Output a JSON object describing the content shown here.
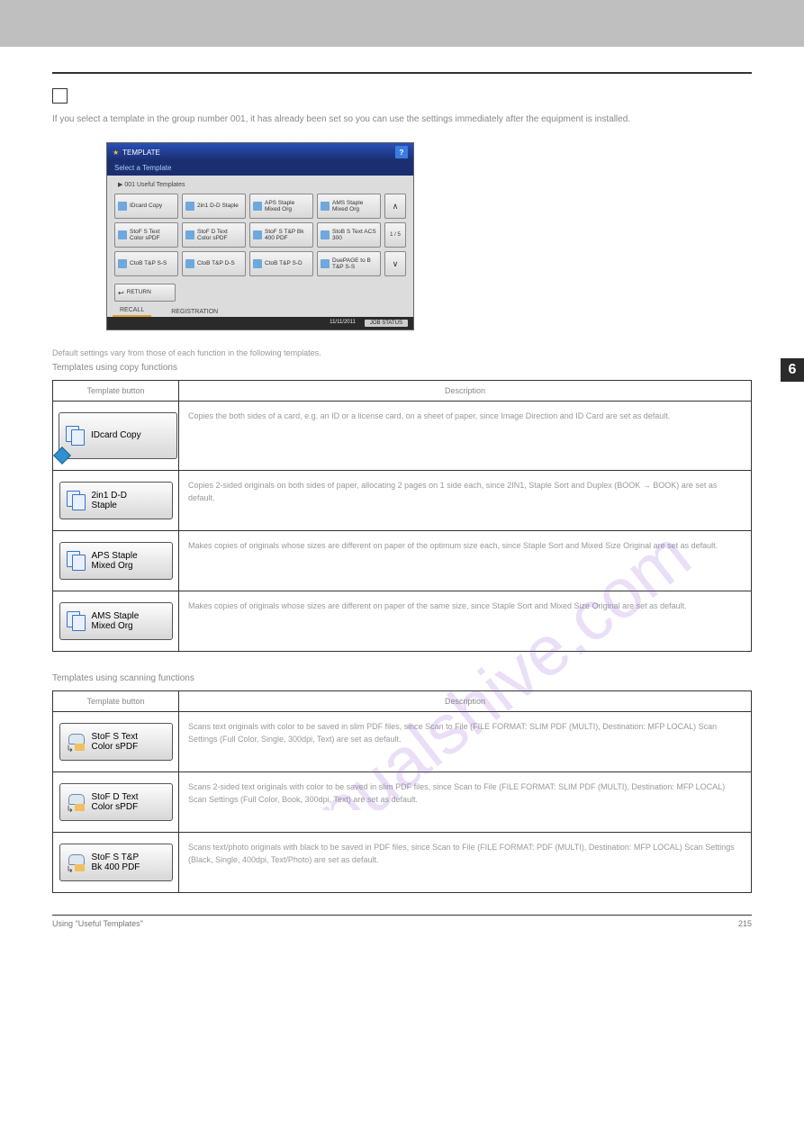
{
  "chapterTab": "6",
  "intro": "If you select a template in the group number 001, it has already been set so you can use the settings immediately after the equipment is installed.",
  "screen": {
    "title": "TEMPLATE",
    "subtitle": "Select a Template",
    "caption": "001 Useful Templates",
    "buttons": [
      [
        {
          "label": "IDcard Copy"
        },
        {
          "label": "2in1 D-D Staple"
        },
        {
          "label": "APS Staple Mixed Org"
        },
        {
          "label": "AMS Staple Mixed Org"
        }
      ],
      [
        {
          "label": "StoF S Text Color sPDF"
        },
        {
          "label": "StoF D Text Color sPDF"
        },
        {
          "label": "StoF S T&P Bk 400 PDF"
        },
        {
          "label": "StoB S Text ACS 300"
        }
      ],
      [
        {
          "label": "CtoB T&P S-S"
        },
        {
          "label": "CtoB T&P D-S"
        },
        {
          "label": "CtoB T&P S-D"
        },
        {
          "label": "DuePAGE to B T&P S-S"
        }
      ]
    ],
    "nav": {
      "up": "∧",
      "page": "1 / 5",
      "down": "∨"
    },
    "return": "RETURN",
    "tabs": {
      "recall": "RECALL",
      "registration": "REGISTRATION"
    },
    "footer": {
      "date": "11/11/2011",
      "job": "JOB STATUS"
    }
  },
  "midnote": "Default settings vary from those of each function in the following templates.",
  "copyTable": {
    "heading": "Templates using copy functions",
    "cols": {
      "c1": "Template button",
      "c2": "Description"
    },
    "rows": [
      {
        "label": "IDcard Copy",
        "desc": "Copies the both sides of a card, e.g. an ID or a license card, on a sheet of paper, since Image Direction and ID Card are set as default.",
        "big": true
      },
      {
        "label": "2in1 D-D\nStaple",
        "desc": "Copies 2-sided originals on both sides of paper, allocating 2 pages on 1 side each, since 2IN1, Staple Sort and Duplex (BOOK → BOOK) are set as default."
      },
      {
        "label": "APS Staple\nMixed Org",
        "desc": "Makes copies of originals whose sizes are different on paper of the optimum size each, since Staple Sort and Mixed Size Original are set as default."
      },
      {
        "label": "AMS Staple\nMixed Org",
        "desc": "Makes copies of originals whose sizes are different on paper of the same size, since Staple Sort and Mixed Size Original are set as default."
      }
    ]
  },
  "scanTable": {
    "heading": "Templates using scanning functions",
    "cols": {
      "c1": "Template button",
      "c2": "Description"
    },
    "rows": [
      {
        "label": "StoF S Text\nColor sPDF",
        "desc": "Scans text originals with color to be saved in slim PDF files, since Scan to File (FILE FORMAT: SLIM PDF (MULTI), Destination: MFP LOCAL) Scan Settings (Full Color, Single, 300dpi, Text) are set as default."
      },
      {
        "label": "StoF D Text\nColor sPDF",
        "desc": "Scans 2-sided text originals with color to be saved in slim PDF files, since Scan to File (FILE FORMAT: SLIM PDF (MULTI), Destination: MFP LOCAL) Scan Settings (Full Color, Book, 300dpi, Text) are set as default."
      },
      {
        "label": "StoF S T&P\nBk 400 PDF",
        "desc": "Scans text/photo originals with black to be saved in PDF files, since Scan to File (FILE FORMAT: PDF (MULTI), Destination: MFP LOCAL) Scan Settings (Black, Single, 400dpi, Text/Photo) are set as default."
      }
    ]
  },
  "footer": {
    "left": "Using \"Useful Templates\"",
    "right": "215"
  }
}
